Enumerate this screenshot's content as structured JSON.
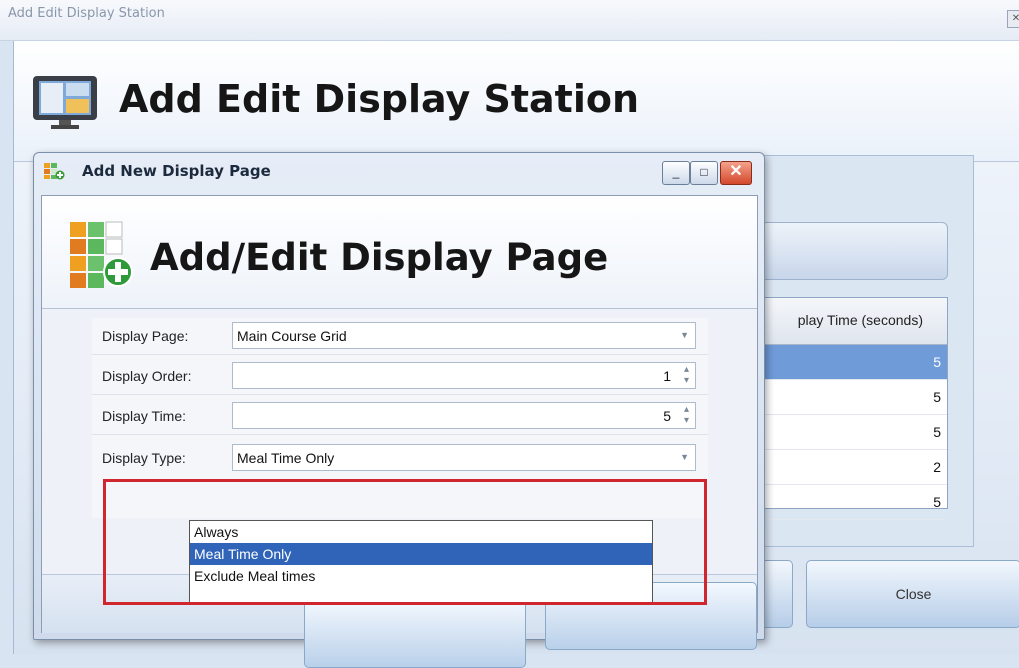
{
  "outer_window": {
    "title": "Add Edit Display Station",
    "header_title": "Add Edit Display Station"
  },
  "background_grid": {
    "column_header": "play Time (seconds)",
    "rows": [
      "5",
      "5",
      "5",
      "2",
      "5"
    ]
  },
  "background_buttons": {
    "close_label": "Close"
  },
  "dialog": {
    "title": "Add New Display Page",
    "header_title": "Add/Edit Display Page",
    "window_buttons": {
      "minimize": "_",
      "maximize": "□",
      "close": "✕"
    },
    "fields": {
      "display_page": {
        "label": "Display Page:",
        "value": "Main Course Grid"
      },
      "display_order": {
        "label": "Display Order:",
        "value": "1"
      },
      "display_time": {
        "label": "Display Time:",
        "value": "5"
      },
      "display_type": {
        "label": "Display Type:",
        "value": "Meal Time Only"
      }
    },
    "display_type_options": [
      "Always",
      "Meal Time Only",
      "Exclude Meal times"
    ],
    "display_type_selected": "Meal Time Only"
  },
  "colors": {
    "highlight": "#d0262d",
    "selection": "#2f64b8"
  }
}
